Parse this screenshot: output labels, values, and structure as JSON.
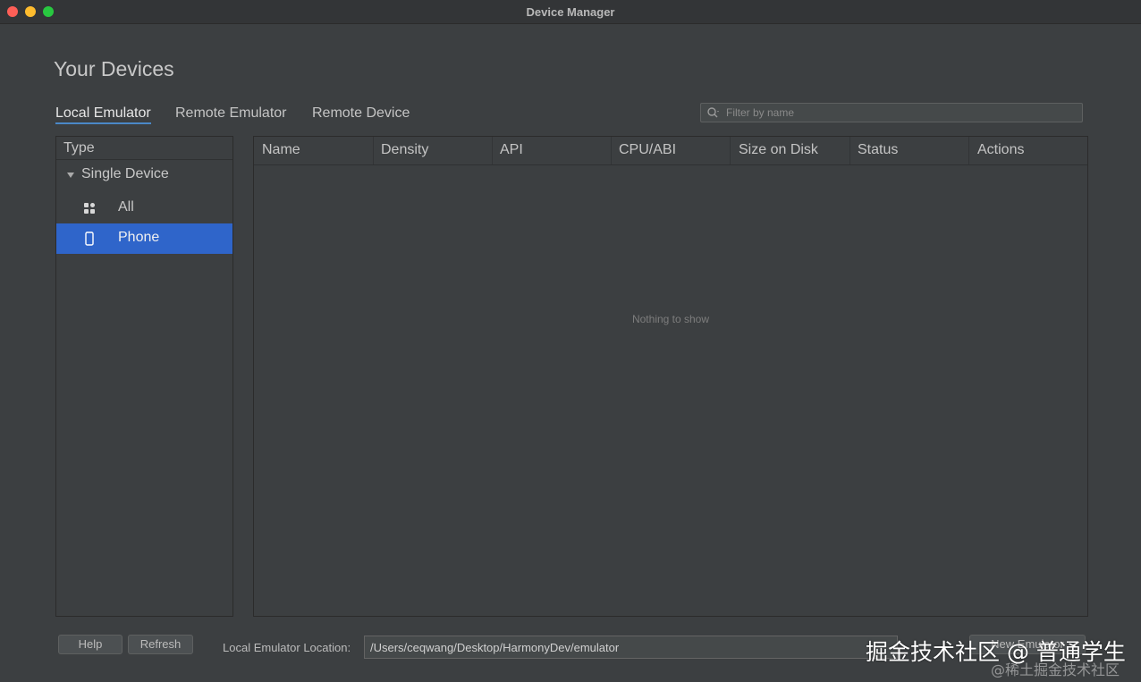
{
  "window": {
    "title": "Device Manager"
  },
  "page_title": "Your Devices",
  "tabs": [
    {
      "label": "Local Emulator",
      "active": true
    },
    {
      "label": "Remote Emulator",
      "active": false
    },
    {
      "label": "Remote Device",
      "active": false
    }
  ],
  "filter": {
    "placeholder": "Filter by name",
    "value": ""
  },
  "type_panel": {
    "header": "Type",
    "group": "Single Device",
    "items": [
      {
        "label": "All",
        "icon": "grid-icon",
        "selected": false
      },
      {
        "label": "Phone",
        "icon": "phone-icon",
        "selected": true
      }
    ]
  },
  "table": {
    "columns": [
      "Name",
      "Density",
      "API",
      "CPU/ABI",
      "Size on Disk",
      "Status",
      "Actions"
    ],
    "empty_text": "Nothing to show"
  },
  "footer": {
    "help_label": "Help",
    "refresh_label": "Refresh",
    "location_label": "Local Emulator Location:",
    "location_value": "/Users/ceqwang/Desktop/HarmonyDev/emulator",
    "new_emulator_label": "New Emulator"
  },
  "watermark": {
    "main": "掘金技术社区 @ 普通学生",
    "sub": "@稀土掘金技术社区"
  },
  "colors": {
    "selection": "#2f65ca",
    "accent": "#4a88c7",
    "background": "#3c3f41"
  }
}
